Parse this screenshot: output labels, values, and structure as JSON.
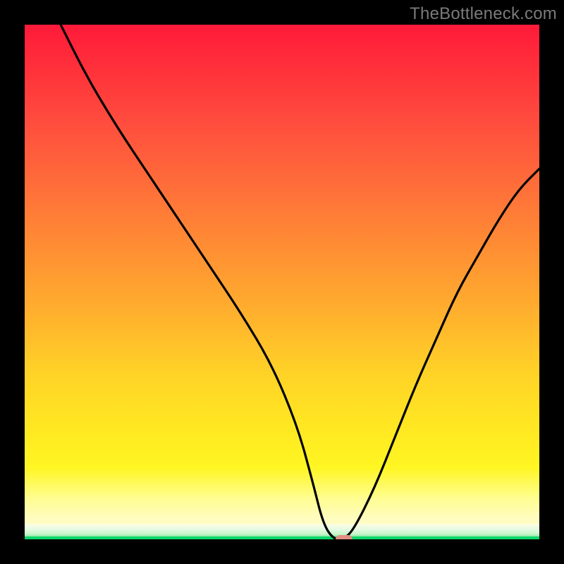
{
  "watermark": "TheBottleneck.com",
  "colors": {
    "accent_marker": "#e09084",
    "green_line": "#0bd66a",
    "gradient_top": "#ff1a3a",
    "gradient_bottom": "#fef9c4"
  },
  "chart_data": {
    "type": "line",
    "title": "",
    "xlabel": "",
    "ylabel": "",
    "xlim": [
      0,
      100
    ],
    "ylim": [
      0,
      100
    ],
    "grid": false,
    "legend": false,
    "series": [
      {
        "name": "curve",
        "x": [
          7,
          12,
          18,
          24,
          30,
          36,
          42,
          48,
          53,
          56,
          58,
          60,
          62,
          64,
          68,
          72,
          76,
          80,
          84,
          88,
          92,
          96,
          100
        ],
        "values": [
          100,
          90,
          80,
          71,
          62,
          53,
          44,
          34,
          22,
          11,
          3,
          0,
          0,
          2,
          10,
          20,
          30,
          39,
          48,
          55,
          62,
          68,
          72
        ]
      }
    ],
    "marker": {
      "x": 62,
      "y": 0
    }
  }
}
